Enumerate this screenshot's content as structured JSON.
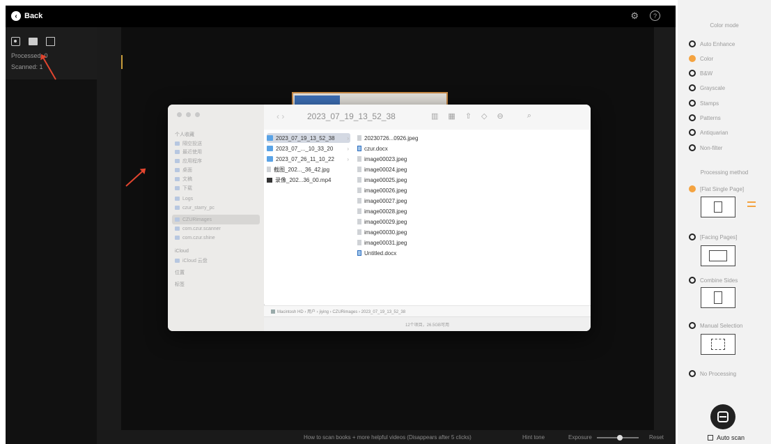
{
  "topbar": {
    "back_label": "Back",
    "icons": [
      "gear-icon",
      "help-icon"
    ]
  },
  "left_panel": {
    "tool_icons": [
      "camera-icon",
      "folder-icon",
      "edit-icon"
    ],
    "processed_label": "Processed: 0",
    "scanned_label": "Scanned: 1"
  },
  "finder": {
    "title": "2023_07_19_13_52_38",
    "sidebar": [
      {
        "label": "个人收藏",
        "kind": "head"
      },
      {
        "label": "隔空投送",
        "kind": "item"
      },
      {
        "label": "最近使用",
        "kind": "item"
      },
      {
        "label": "应用程序",
        "kind": "item"
      },
      {
        "label": "桌面",
        "kind": "item"
      },
      {
        "label": "文稿",
        "kind": "item"
      },
      {
        "label": "下载",
        "kind": "item"
      },
      {
        "label": "Logs",
        "kind": "item"
      },
      {
        "label": "czur_starry_pc",
        "kind": "item"
      },
      {
        "label": "CZURimages",
        "kind": "selected"
      },
      {
        "label": "com.czur.scanner",
        "kind": "item"
      },
      {
        "label": "com.czur.shine",
        "kind": "item"
      },
      {
        "label": "iCloud",
        "kind": "head"
      },
      {
        "label": "iCloud 云盘",
        "kind": "item"
      },
      {
        "label": "位置",
        "kind": "head"
      },
      {
        "label": "标签",
        "kind": "head"
      }
    ],
    "column1": [
      {
        "name": "2023_07_19_13_52_38",
        "type": "folder",
        "selected": true
      },
      {
        "name": "2023_07_..._10_33_20",
        "type": "folder"
      },
      {
        "name": "2023_07_26_11_10_22",
        "type": "folder"
      },
      {
        "name": "截图_202..._36_42.jpg",
        "type": "image"
      },
      {
        "name": "录像_202...36_00.mp4",
        "type": "video"
      }
    ],
    "column2": [
      {
        "name": "20230726...0926.jpeg",
        "type": "image"
      },
      {
        "name": "czur.docx",
        "type": "doc"
      },
      {
        "name": "image00023.jpeg",
        "type": "image"
      },
      {
        "name": "image00024.jpeg",
        "type": "image"
      },
      {
        "name": "image00025.jpeg",
        "type": "image"
      },
      {
        "name": "image00026.jpeg",
        "type": "image"
      },
      {
        "name": "image00027.jpeg",
        "type": "image"
      },
      {
        "name": "image00028.jpeg",
        "type": "image"
      },
      {
        "name": "image00029.jpeg",
        "type": "image"
      },
      {
        "name": "image00030.jpeg",
        "type": "image"
      },
      {
        "name": "image00031.jpeg",
        "type": "image"
      },
      {
        "name": "Untitled.docx",
        "type": "doc"
      }
    ],
    "path": "Macintosh HD › 用户 › jiying › CZURimages › 2023_07_19_13_52_38",
    "status": "12个项目，26.5GB可用"
  },
  "bottom_bar": {
    "hint": "How to scan books + more helpful videos (Disappears after 5 clicks)",
    "hint_label": "Hint tone",
    "exposure_label": "Exposure",
    "exposure_level": 0.55,
    "reset_label": "Reset"
  },
  "right_panel": {
    "color_mode_label": "Color mode",
    "color_modes": [
      {
        "label": "Auto Enhance",
        "selected": false
      },
      {
        "label": "Color",
        "selected": true
      },
      {
        "label": "B&W",
        "selected": false
      },
      {
        "label": "Grayscale",
        "selected": false
      },
      {
        "label": "Stamps",
        "selected": false
      },
      {
        "label": "Patterns",
        "selected": false
      },
      {
        "label": "Antiquarian",
        "selected": false
      },
      {
        "label": "Non-filter",
        "selected": false
      }
    ],
    "processing_label": "Processing method",
    "processing_methods": [
      {
        "label": "[Flat Single Page]",
        "selected": true
      },
      {
        "label": "[Facing Pages]",
        "selected": false
      },
      {
        "label": "Combine Sides",
        "selected": false
      },
      {
        "label": "Manual Selection",
        "selected": false
      },
      {
        "label": "No Processing",
        "selected": false
      }
    ],
    "auto_scan_label": "Auto scan",
    "accent_color": "#f4a340"
  }
}
